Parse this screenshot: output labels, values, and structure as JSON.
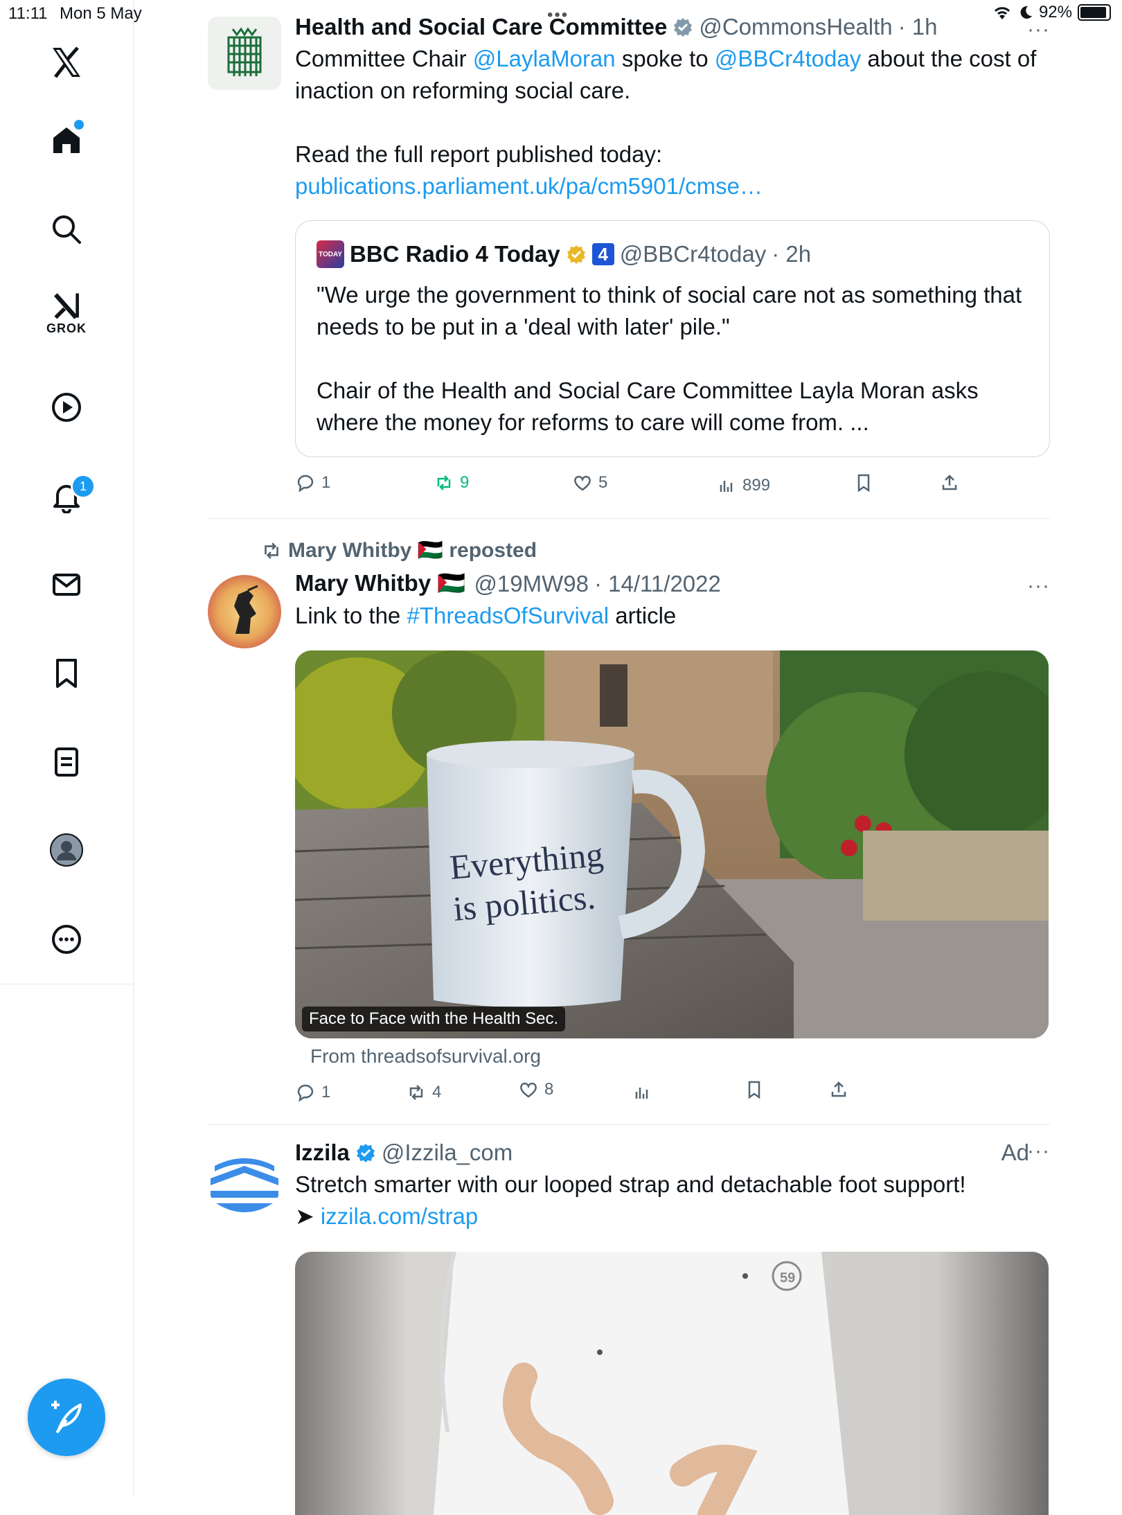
{
  "status": {
    "time": "11:11",
    "date": "Mon 5 May",
    "battery": "92%"
  },
  "sidebar": {
    "grok_label": "GROK",
    "notifications_count": "1"
  },
  "tweets": [
    {
      "name": "Health and Social Care Committee",
      "handle": "@CommonsHealth",
      "time": "· 1h",
      "text_parts": [
        "Committee Chair ",
        "@LaylaMoran",
        "  spoke to ",
        "@BBCr4today",
        "  about the cost of inaction on reforming social care."
      ],
      "text2": "Read the full report published today: ",
      "link": "publications.parliament.uk/pa/cm5901/cmse…",
      "quote": {
        "name": "BBC Radio 4 Today",
        "handle": "@BBCr4today",
        "time": "· 2h",
        "channel": "4",
        "logo_text": "TODAY",
        "text1": "\"We urge the government to think of social care not as something that needs to be put in a 'deal with later' pile.\"",
        "text2": "Chair of the Health and Social Care Committee Layla Moran asks where the money for reforms to care will come from. ..."
      },
      "stats": {
        "replies": "1",
        "reposts": "9",
        "likes": "5",
        "views": "899"
      }
    },
    {
      "reposted_by": "Mary Whitby 🇵🇸 reposted",
      "name": "Mary Whitby 🇵🇸",
      "handle": "@19MW98",
      "time": "· 14/11/2022",
      "text_parts": [
        "Link to the ",
        "#ThreadsOfSurvival",
        " article"
      ],
      "media_caption": "Face to Face with the Health Sec.",
      "mug_text_1": "Everything",
      "mug_text_2": "is politics.",
      "source": "From threadsofsurvival.org",
      "stats": {
        "replies": "1",
        "reposts": "4",
        "likes": "8",
        "views": ""
      }
    },
    {
      "name": "Izzila",
      "handle": "@Izzila_com",
      "ad_label": "Ad",
      "text": "Stretch smarter with our looped strap and detachable foot support!",
      "arrow": "➤ ",
      "link": "izzila.com/strap",
      "shirt_badge": "59"
    }
  ],
  "colors": {
    "accent": "#1d9bf0",
    "repost_green": "#00ba7c",
    "gold_check": "#e8b829"
  }
}
